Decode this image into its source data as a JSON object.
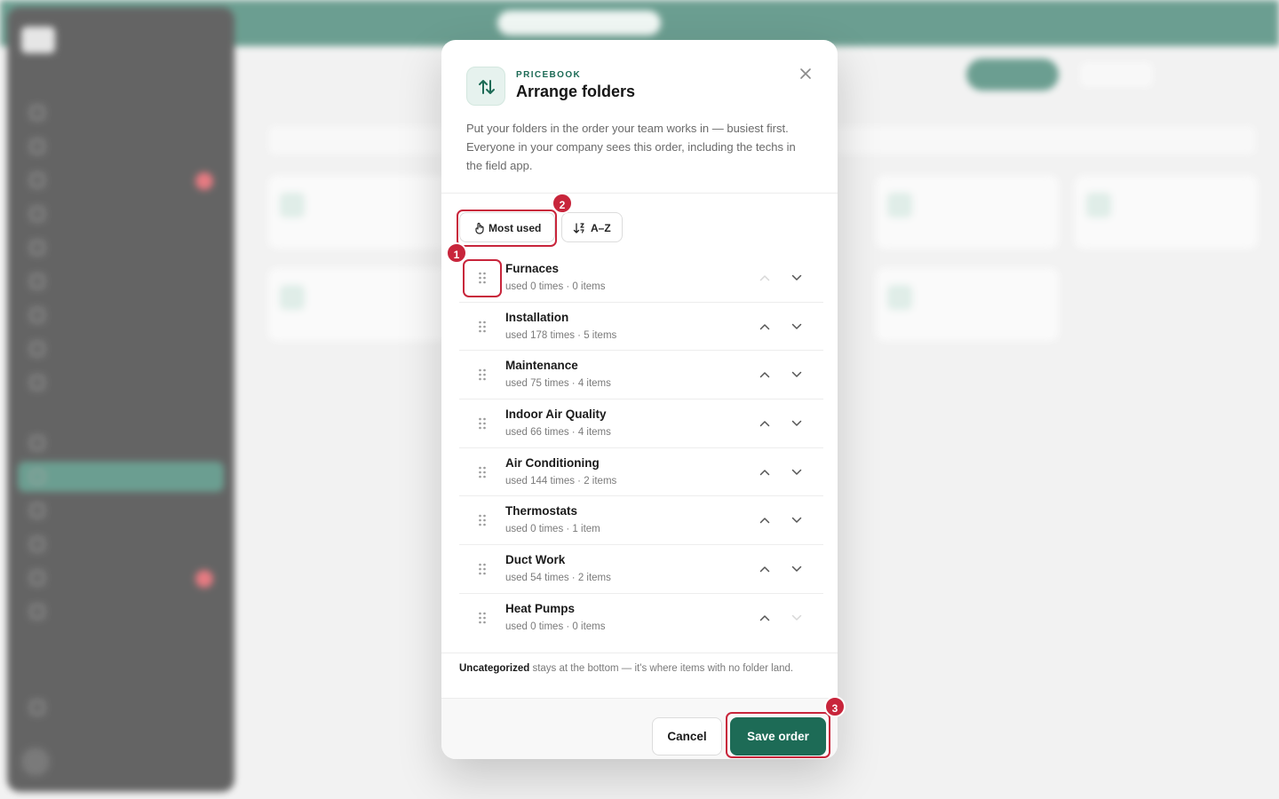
{
  "modal": {
    "eyebrow": "PRICEBOOK",
    "title": "Arrange folders",
    "description": "Put your folders in the order your team works in — busiest first. Everyone in your company sees this order, including the techs in the field app.",
    "icon": "arrows-up-down-icon",
    "close_icon": "close-icon",
    "sort_buttons": [
      {
        "label": "Most used",
        "icon": "hand-pointer-icon"
      },
      {
        "label": "A–Z",
        "icon": "sort-alpha-icon"
      }
    ],
    "folders": [
      {
        "name": "Furnaces",
        "meta": "used 0 times · 0 items",
        "up_disabled": true,
        "down_disabled": false
      },
      {
        "name": "Installation",
        "meta": "used 178 times · 5 items",
        "up_disabled": false,
        "down_disabled": false
      },
      {
        "name": "Maintenance",
        "meta": "used 75 times · 4 items",
        "up_disabled": false,
        "down_disabled": false
      },
      {
        "name": "Indoor Air Quality",
        "meta": "used 66 times · 4 items",
        "up_disabled": false,
        "down_disabled": false
      },
      {
        "name": "Air Conditioning",
        "meta": "used 144 times · 2 items",
        "up_disabled": false,
        "down_disabled": false
      },
      {
        "name": "Thermostats",
        "meta": "used 0 times · 1 item",
        "up_disabled": false,
        "down_disabled": false
      },
      {
        "name": "Duct Work",
        "meta": "used 54 times · 2 items",
        "up_disabled": false,
        "down_disabled": false
      },
      {
        "name": "Heat Pumps",
        "meta": "used 0 times · 0 items",
        "up_disabled": false,
        "down_disabled": true
      }
    ],
    "note_strong": "Uncategorized",
    "note_rest": " stays at the bottom — it's where items with no folder land.",
    "cancel_label": "Cancel",
    "save_label": "Save order"
  },
  "callouts": [
    "1",
    "2",
    "3"
  ],
  "colors": {
    "brand": "#1d6b56",
    "callout": "#c8253b"
  }
}
